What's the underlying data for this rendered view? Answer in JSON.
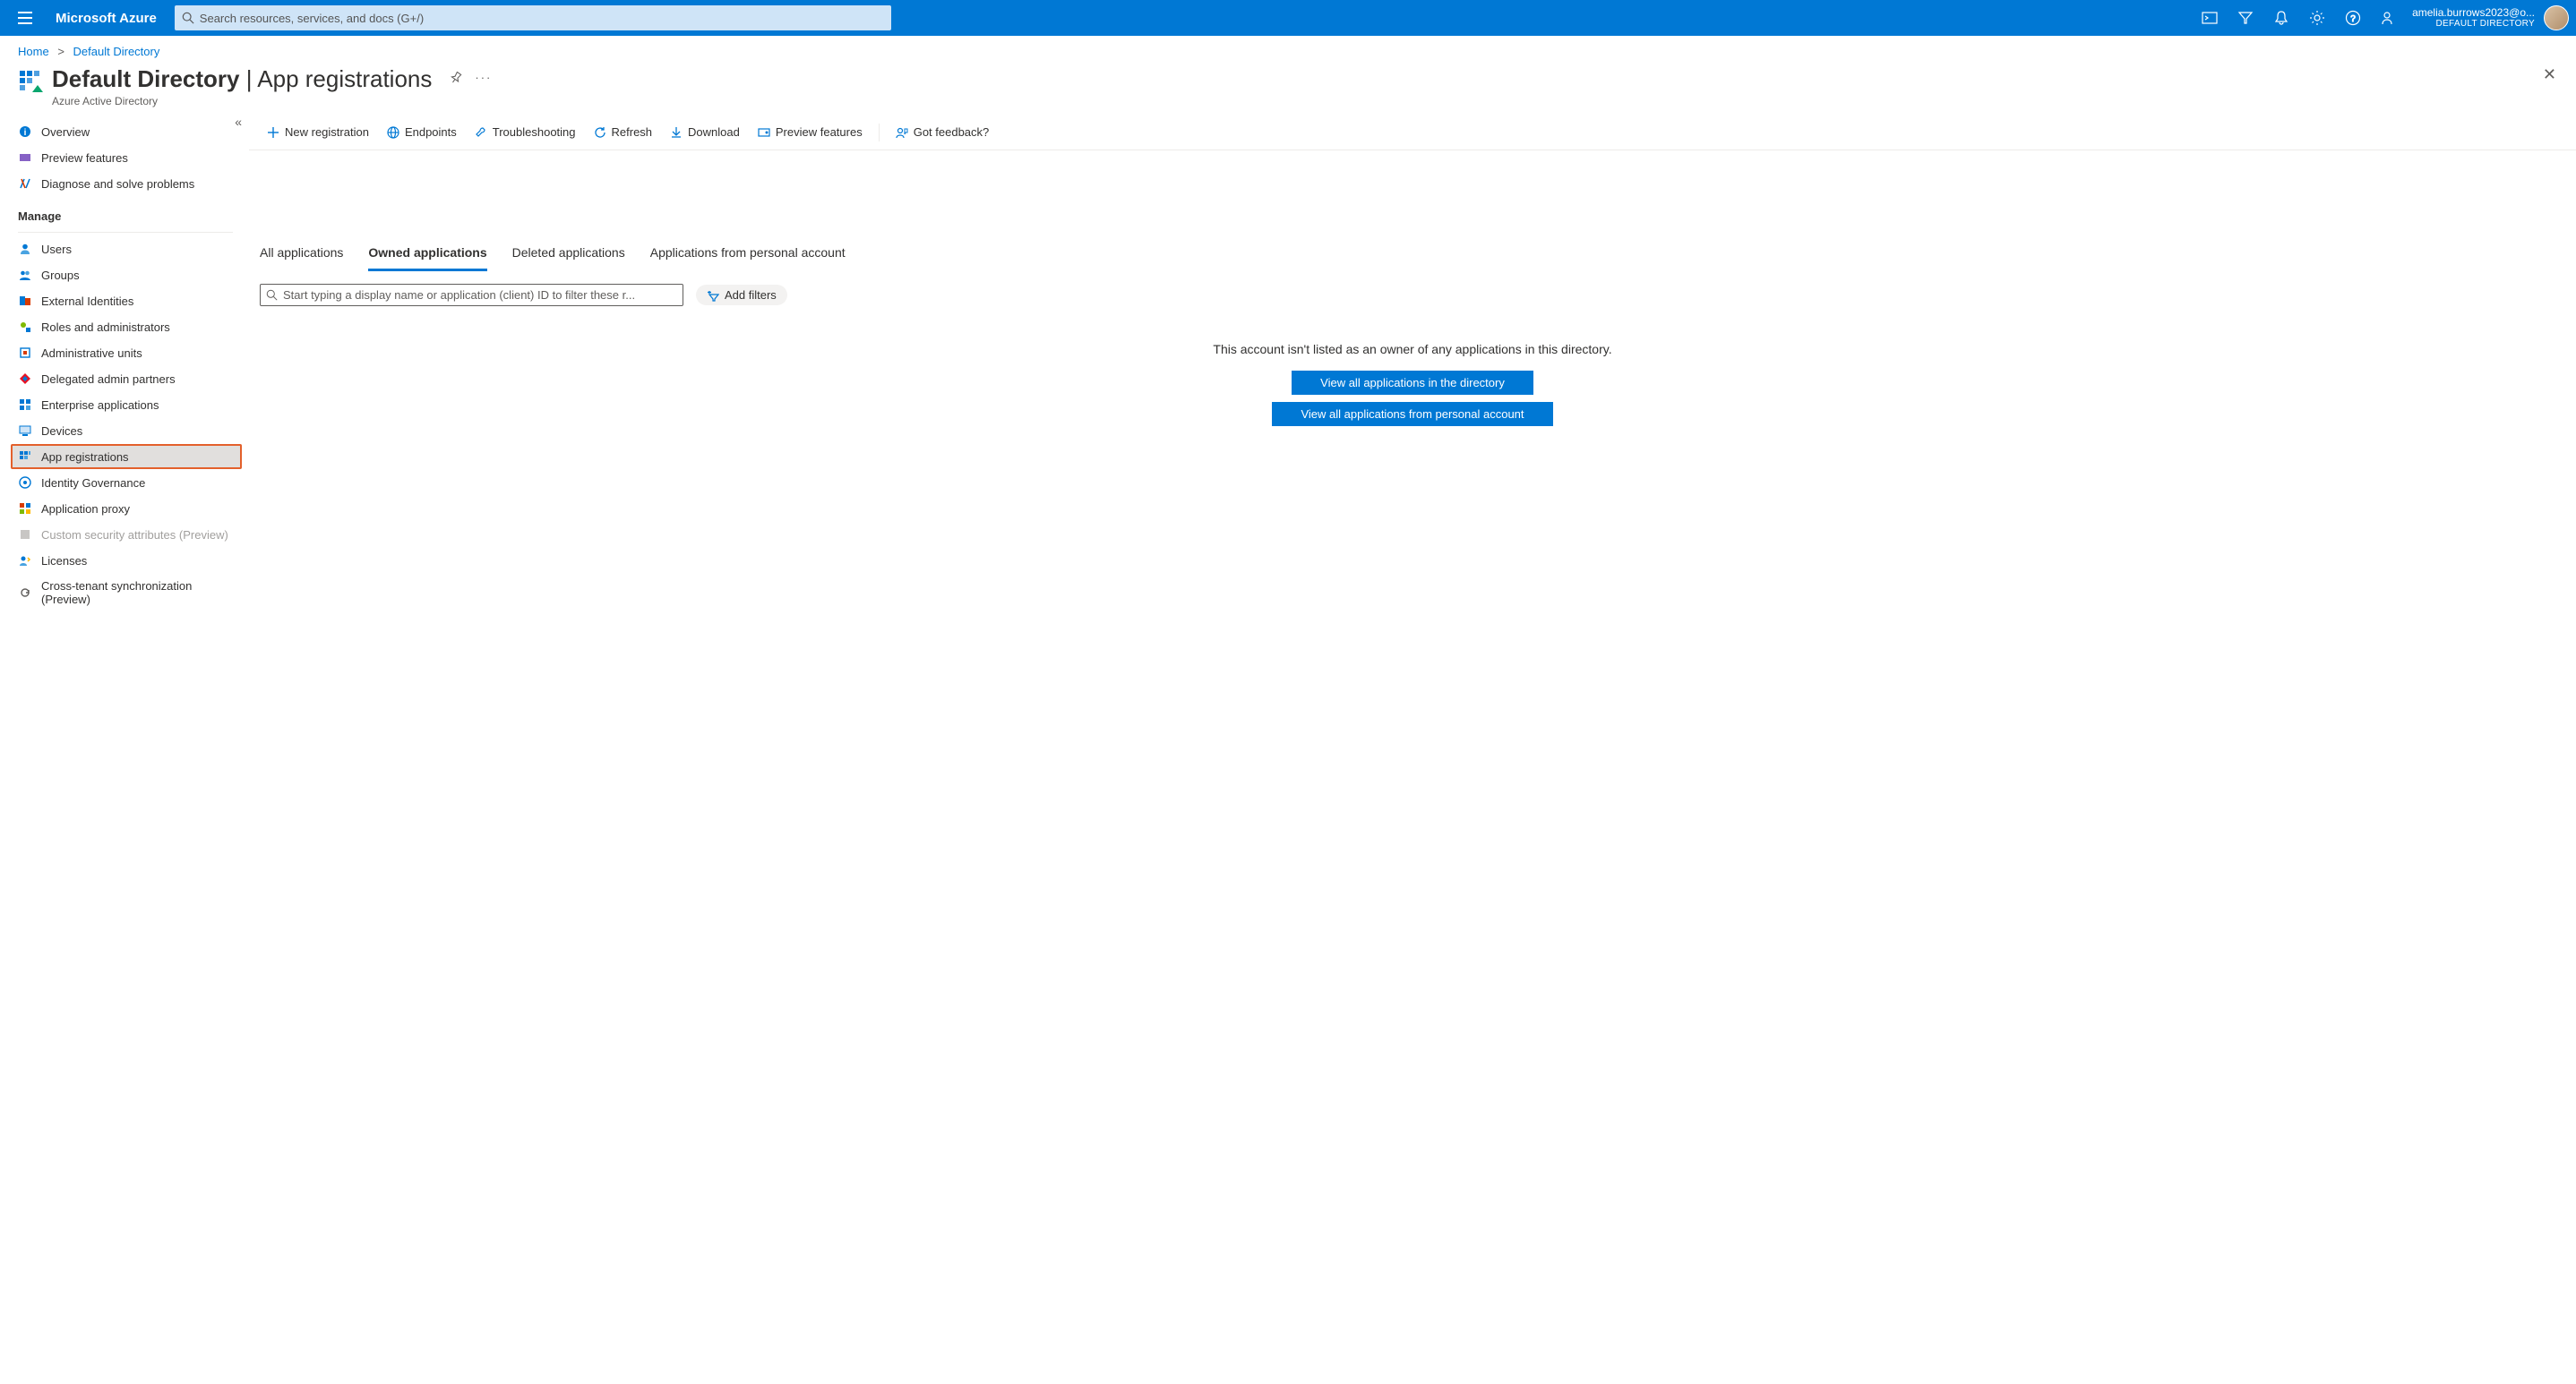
{
  "topbar": {
    "brand": "Microsoft Azure",
    "search_placeholder": "Search resources, services, and docs (G+/)",
    "account_email": "amelia.burrows2023@o...",
    "account_directory": "DEFAULT DIRECTORY"
  },
  "breadcrumb": {
    "home": "Home",
    "current": "Default Directory"
  },
  "page": {
    "title_bold": "Default Directory",
    "title_rest": " | App registrations",
    "subtitle": "Azure Active Directory"
  },
  "toolbar": {
    "new_registration": "New registration",
    "endpoints": "Endpoints",
    "troubleshooting": "Troubleshooting",
    "refresh": "Refresh",
    "download": "Download",
    "preview_features": "Preview features",
    "got_feedback": "Got feedback?"
  },
  "sidebar": {
    "top": [
      {
        "label": "Overview"
      },
      {
        "label": "Preview features"
      },
      {
        "label": "Diagnose and solve problems"
      }
    ],
    "group_manage": "Manage",
    "manage": [
      {
        "label": "Users"
      },
      {
        "label": "Groups"
      },
      {
        "label": "External Identities"
      },
      {
        "label": "Roles and administrators"
      },
      {
        "label": "Administrative units"
      },
      {
        "label": "Delegated admin partners"
      },
      {
        "label": "Enterprise applications"
      },
      {
        "label": "Devices"
      },
      {
        "label": "App registrations"
      },
      {
        "label": "Identity Governance"
      },
      {
        "label": "Application proxy"
      },
      {
        "label": "Custom security attributes (Preview)"
      },
      {
        "label": "Licenses"
      },
      {
        "label": "Cross-tenant synchronization (Preview)"
      }
    ]
  },
  "tabs": {
    "all": "All applications",
    "owned": "Owned applications",
    "deleted": "Deleted applications",
    "personal": "Applications from personal account"
  },
  "filter": {
    "placeholder": "Start typing a display name or application (client) ID to filter these r...",
    "add_filters": "Add filters"
  },
  "empty": {
    "message": "This account isn't listed as an owner of any applications in this directory.",
    "view_all": "View all applications in the directory",
    "view_personal": "View all applications from personal account"
  }
}
